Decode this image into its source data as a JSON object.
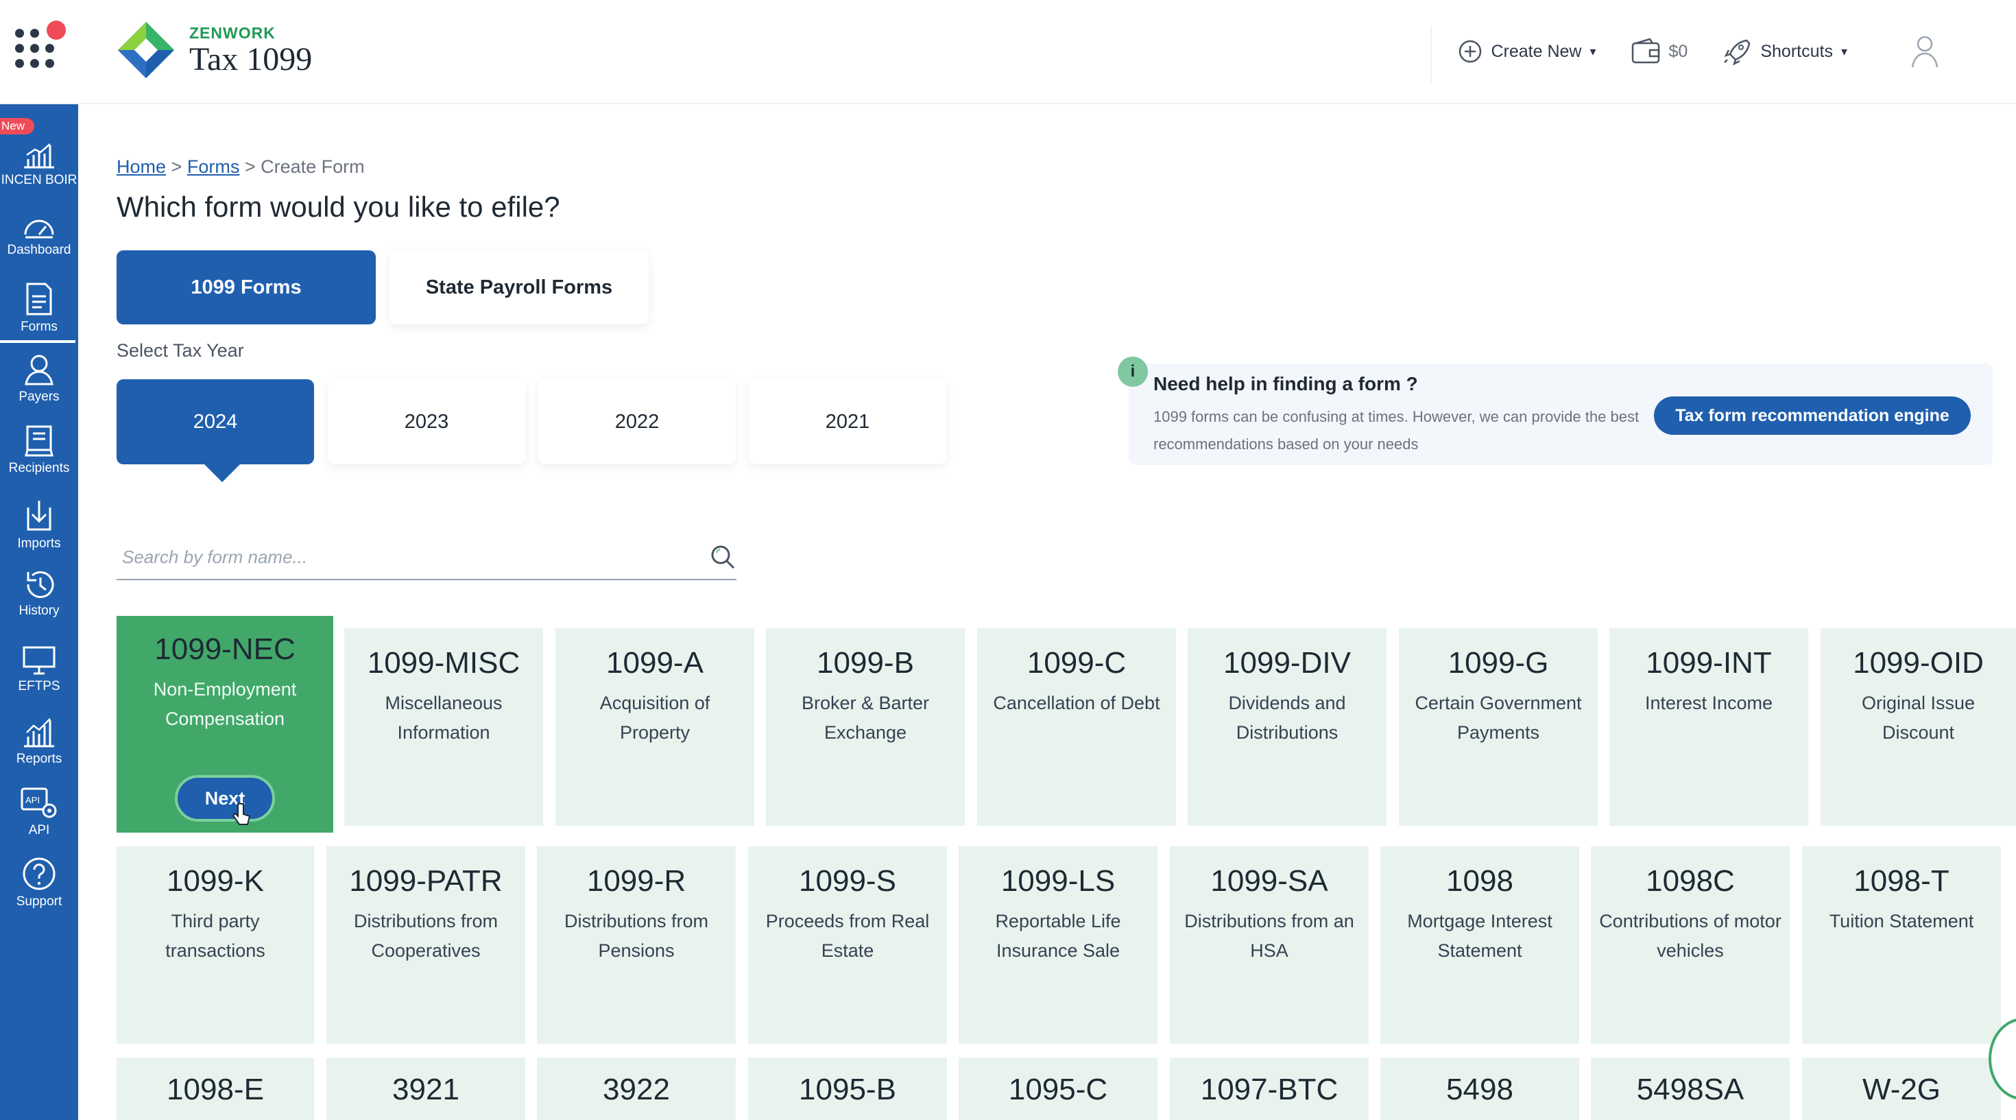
{
  "header": {
    "brand": "ZENWORK",
    "product": "Tax 1099",
    "create_new": "Create New",
    "cart_amount": "$0",
    "shortcuts": "Shortcuts"
  },
  "sidebar": {
    "new_badge": "New",
    "items": [
      {
        "label": "INCEN BOIR",
        "icon": "bar-chart-icon"
      },
      {
        "label": "Dashboard",
        "icon": "gauge-icon"
      },
      {
        "label": "Forms",
        "icon": "document-icon"
      },
      {
        "label": "Payers",
        "icon": "user-icon"
      },
      {
        "label": "Recipients",
        "icon": "recipient-icon"
      },
      {
        "label": "Imports",
        "icon": "download-icon"
      },
      {
        "label": "History",
        "icon": "history-icon"
      },
      {
        "label": "EFTPS",
        "icon": "monitor-icon"
      },
      {
        "label": "Reports",
        "icon": "reports-icon"
      },
      {
        "label": "API",
        "icon": "api-icon"
      },
      {
        "label": "Support",
        "icon": "help-icon"
      }
    ],
    "active": "Forms"
  },
  "breadcrumb": {
    "home": "Home",
    "forms": "Forms",
    "current": "Create Form"
  },
  "page_title": "Which form would you like to efile?",
  "form_tabs": [
    "1099 Forms",
    "State Payroll Forms"
  ],
  "tax_year": {
    "label": "Select Tax Year",
    "years": [
      "2024",
      "2023",
      "2022",
      "2021"
    ],
    "selected": "2024"
  },
  "help": {
    "icon": "i",
    "title": "Need help in finding a form ?",
    "desc": "1099 forms can be confusing at times. However, we can provide the best recommendations based on your needs",
    "button": "Tax form recommendation engine"
  },
  "search": {
    "placeholder": "Search by form name..."
  },
  "forms": {
    "next_label": "Next",
    "row1": [
      {
        "code": "1099-NEC",
        "desc": "Non-Employment Compensation"
      },
      {
        "code": "1099-MISC",
        "desc": "Miscellaneous Information"
      },
      {
        "code": "1099-A",
        "desc": "Acquisition of Property"
      },
      {
        "code": "1099-B",
        "desc": "Broker & Barter Exchange"
      },
      {
        "code": "1099-C",
        "desc": "Cancellation of Debt"
      },
      {
        "code": "1099-DIV",
        "desc": "Dividends and Distributions"
      },
      {
        "code": "1099-G",
        "desc": "Certain Government Payments"
      },
      {
        "code": "1099-INT",
        "desc": "Interest Income"
      },
      {
        "code": "1099-OID",
        "desc": "Original Issue Discount"
      }
    ],
    "row2": [
      {
        "code": "1099-K",
        "desc": "Third party transactions"
      },
      {
        "code": "1099-PATR",
        "desc": "Distributions from Cooperatives"
      },
      {
        "code": "1099-R",
        "desc": "Distributions from Pensions"
      },
      {
        "code": "1099-S",
        "desc": "Proceeds from Real Estate"
      },
      {
        "code": "1099-LS",
        "desc": "Reportable Life Insurance Sale"
      },
      {
        "code": "1099-SA",
        "desc": "Distributions from an HSA"
      },
      {
        "code": "1098",
        "desc": "Mortgage Interest Statement"
      },
      {
        "code": "1098C",
        "desc": "Contributions of motor vehicles"
      },
      {
        "code": "1098-T",
        "desc": "Tuition Statement"
      }
    ],
    "row3": [
      {
        "code": "1098-E"
      },
      {
        "code": "3921"
      },
      {
        "code": "3922"
      },
      {
        "code": "1095-B"
      },
      {
        "code": "1095-C"
      },
      {
        "code": "1097-BTC"
      },
      {
        "code": "5498"
      },
      {
        "code": "5498SA"
      },
      {
        "code": "W-2G"
      }
    ]
  },
  "colors": {
    "primary": "#1f5fae",
    "selected_card": "#41a86a",
    "card": "#e8f3ee",
    "accent_red": "#ef4c57"
  }
}
